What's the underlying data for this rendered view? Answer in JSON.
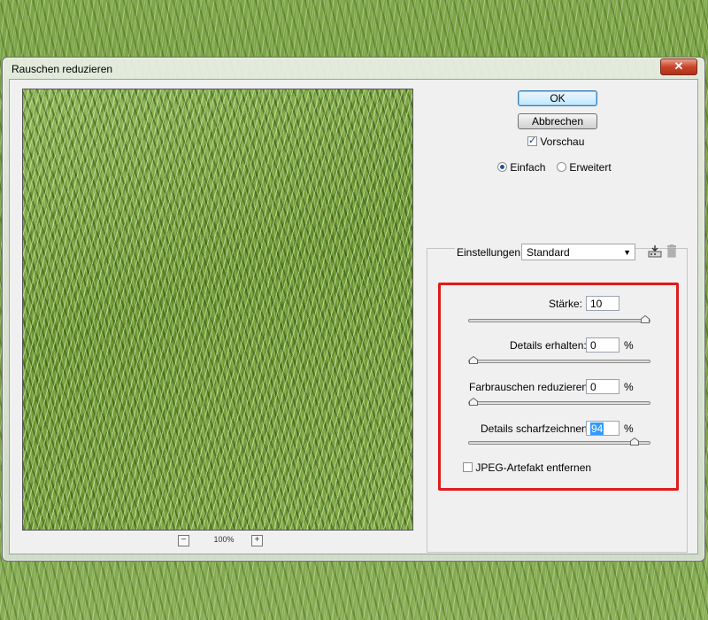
{
  "window": {
    "title": "Rauschen reduzieren",
    "close_glyph": "✕"
  },
  "preview": {
    "zoom_out": "−",
    "zoom_in": "+",
    "zoom_level": "100%"
  },
  "buttons": {
    "ok": "OK",
    "cancel": "Abbrechen"
  },
  "preview_toggle": {
    "label": "Vorschau",
    "checked": true
  },
  "mode": {
    "simple": "Einfach",
    "advanced": "Erweitert",
    "selected": "simple"
  },
  "settings": {
    "label": "Einstellungen:",
    "value": "Standard"
  },
  "controls": {
    "strength": {
      "label": "Stärke:",
      "value": "10",
      "unit": "",
      "max": 10
    },
    "preserve_details": {
      "label": "Details erhalten:",
      "value": "0",
      "unit": "%",
      "max": 100
    },
    "reduce_color_noise": {
      "label": "Farbrauschen reduzieren:",
      "value": "0",
      "unit": "%",
      "max": 100
    },
    "sharpen_details": {
      "label": "Details scharfzeichnen:",
      "value": "94",
      "unit": "%",
      "max": 100
    }
  },
  "jpeg_artifact": {
    "label": "JPEG-Artefakt entfernen",
    "checked": false
  },
  "colors": {
    "highlight_box": "#e01b1b",
    "selection": "#3399ff"
  }
}
